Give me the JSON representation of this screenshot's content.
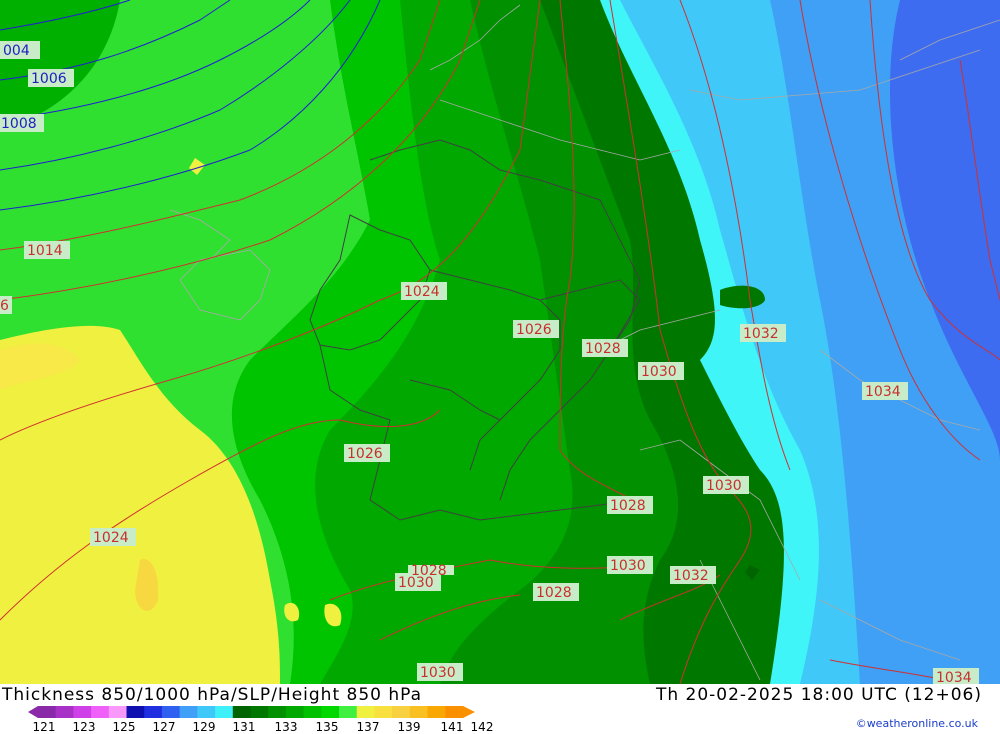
{
  "map": {
    "isobar_labels_red": [
      "1014",
      "6",
      "1024",
      "1026",
      "1026",
      "1024",
      "1028",
      "1030",
      "1032",
      "1034",
      "1030",
      "1028",
      "1030",
      "1028",
      "1030",
      "1032",
      "1028",
      "1030",
      "1034"
    ],
    "isobar_labels_blue": [
      "004",
      "1006",
      "1008"
    ]
  },
  "footer": {
    "title": "Thickness 850/1000 hPa/SLP/Height 850 hPa",
    "datetime": "Th 20-02-2025 18:00 UTC (12+06)",
    "credit": "©weatheronline.co.uk"
  },
  "legend": {
    "ticks": [
      "121",
      "123",
      "125",
      "127",
      "129",
      "131",
      "133",
      "135",
      "137",
      "139",
      "141",
      "142"
    ],
    "colors": [
      "#8a2aa8",
      "#a832c8",
      "#d040e8",
      "#f060f8",
      "#f898f8",
      "#1010b0",
      "#2030e0",
      "#3060f0",
      "#40a0f8",
      "#40c8f8",
      "#40f0f8",
      "#006400",
      "#007800",
      "#009000",
      "#00a800",
      "#00c000",
      "#00d800",
      "#40f040",
      "#f0f040",
      "#f8e040",
      "#f8d040",
      "#f8c020",
      "#f8a800",
      "#f89000"
    ]
  }
}
